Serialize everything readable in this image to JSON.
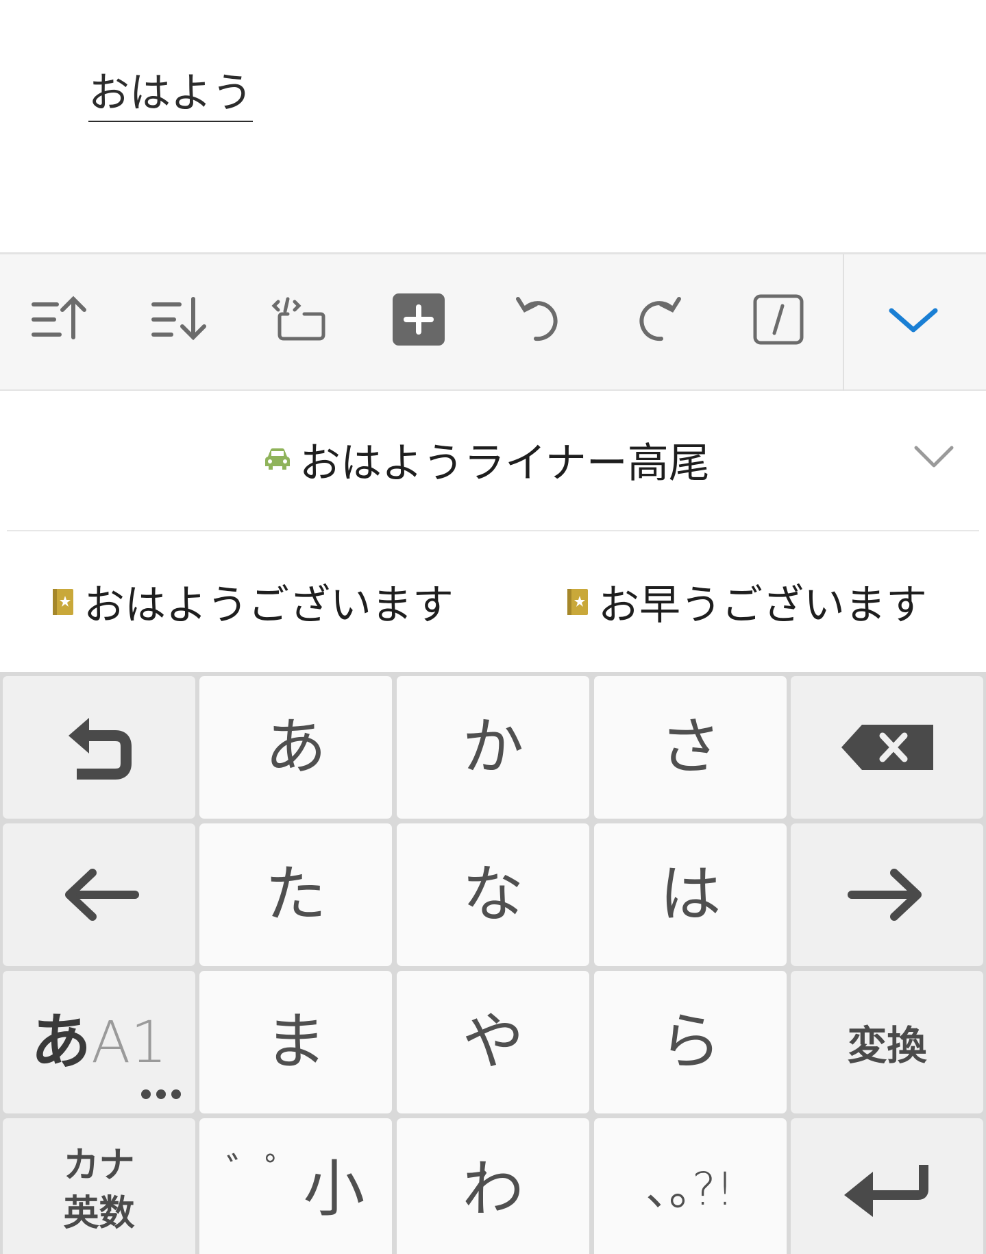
{
  "composing": {
    "text": "おはよう"
  },
  "toolbar": {
    "buttons": [
      {
        "name": "sort-up-icon"
      },
      {
        "name": "sort-down-icon"
      },
      {
        "name": "cursor-select-icon"
      },
      {
        "name": "add-box-icon"
      },
      {
        "name": "undo-icon"
      },
      {
        "name": "redo-icon"
      },
      {
        "name": "slash-box-icon"
      }
    ],
    "collapse": {
      "name": "chevron-down-icon",
      "color": "#1a7fd4"
    }
  },
  "candidates": {
    "primary": {
      "label": "おはようライナー高尾",
      "icon": "car-icon",
      "icon_color": "#8fb35a"
    },
    "expand_icon": "chevron-down-icon",
    "items": [
      {
        "label": "おはようございます",
        "icon": "dictionary-icon"
      },
      {
        "label": "お早うございます",
        "icon": "dictionary-icon"
      }
    ]
  },
  "keyboard": {
    "rows": [
      [
        {
          "type": "icon",
          "name": "undo-key",
          "icon": "undo-icon"
        },
        {
          "type": "kana",
          "label": "あ"
        },
        {
          "type": "kana",
          "label": "か"
        },
        {
          "type": "kana",
          "label": "さ"
        },
        {
          "type": "icon",
          "name": "backspace-key",
          "icon": "backspace-icon"
        }
      ],
      [
        {
          "type": "icon",
          "name": "cursor-left-key",
          "icon": "arrow-left-icon"
        },
        {
          "type": "kana",
          "label": "た"
        },
        {
          "type": "kana",
          "label": "な"
        },
        {
          "type": "kana",
          "label": "は"
        },
        {
          "type": "icon",
          "name": "cursor-right-key",
          "icon": "arrow-right-icon"
        }
      ],
      [
        {
          "type": "mode",
          "main": "あ",
          "sub": "A1"
        },
        {
          "type": "kana",
          "label": "ま"
        },
        {
          "type": "kana",
          "label": "や"
        },
        {
          "type": "kana",
          "label": "ら"
        },
        {
          "type": "bold",
          "label": "変換"
        }
      ],
      [
        {
          "type": "kana-eisu",
          "line1": "カナ",
          "line2": "英数"
        },
        {
          "type": "dakuten",
          "marks": "゛゜",
          "label": "小"
        },
        {
          "type": "kana",
          "label": "わ"
        },
        {
          "type": "kana-small",
          "label": "､｡?!"
        },
        {
          "type": "icon",
          "name": "enter-key",
          "icon": "enter-icon"
        }
      ]
    ]
  }
}
